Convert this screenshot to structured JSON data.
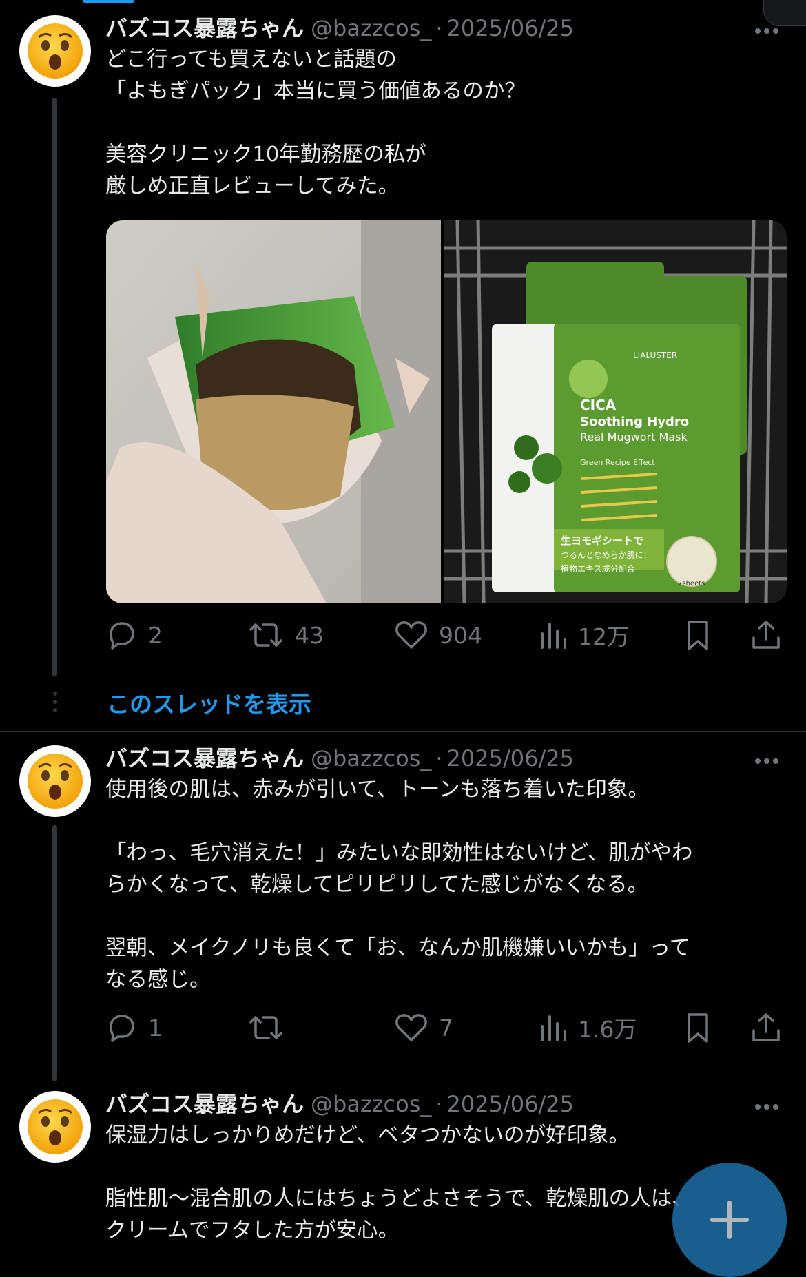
{
  "posts": [
    {
      "author_name": "バズコス暴露ちゃん",
      "handle": "@bazzcos_",
      "separator": "·",
      "date": "2025/06/25",
      "lines": [
        "どこ行っても買えないと話題の",
        "「よもぎパック」本当に買う価値あるのか？",
        "",
        "美容クリニック10年勤務歴の私が",
        "厳しめ正直レビューしてみた。"
      ],
      "media": {
        "left_alt": "よもぎパックの中身を手で開いて見せている写真",
        "right": {
          "brand": "LIALUSTER",
          "line1": "CICA",
          "line2": "Soothing Hydro",
          "line3": "Real Mugwort Mask",
          "subtitle": "Green Recipe Effect",
          "callout1": "生ヨモギシートで",
          "callout2": "つるんとなめらか肌に！",
          "extract": "植物エキス成分配合",
          "count": "7sheets"
        }
      },
      "stats": {
        "replies": "2",
        "reposts": "43",
        "likes": "904",
        "views": "12万"
      }
    },
    {
      "author_name": "バズコス暴露ちゃん",
      "handle": "@bazzcos_",
      "separator": "·",
      "date": "2025/06/25",
      "lines": [
        "使用後の肌は、赤みが引いて、トーンも落ち着いた印象。",
        "",
        "「わっ、毛穴消えた！」みたいな即効性はないけど、肌がやわ",
        "らかくなって、乾燥してピリピリしてた感じがなくなる。",
        "",
        "翌朝、メイクノリも良くて「お、なんか肌機嫌いいかも」って",
        "なる感じ。"
      ],
      "stats": {
        "replies": "1",
        "reposts": "",
        "likes": "7",
        "views": "1.6万"
      }
    },
    {
      "author_name": "バズコス暴露ちゃん",
      "handle": "@bazzcos_",
      "separator": "·",
      "date": "2025/06/25",
      "lines": [
        "保湿力はしっかりめだけど、ベタつかないのが好印象。",
        "",
        "脂性肌〜混合肌の人にはちょうどよさそうで、乾燥肌の人は、",
        "クリームでフタした方が安心。"
      ]
    }
  ],
  "show_thread_label": "このスレッドを表示",
  "icons": {
    "avatar": "astonished-face-emoji",
    "reply": "reply-icon",
    "repost": "repost-icon",
    "like": "heart-icon",
    "views": "views-icon",
    "bookmark": "bookmark-icon",
    "share": "share-icon",
    "more": "more-icon",
    "fab": "plus-icon"
  },
  "colors": {
    "background": "#000000",
    "text": "#e7e9ea",
    "secondary": "#71767b",
    "accent": "#1d9bf0"
  }
}
